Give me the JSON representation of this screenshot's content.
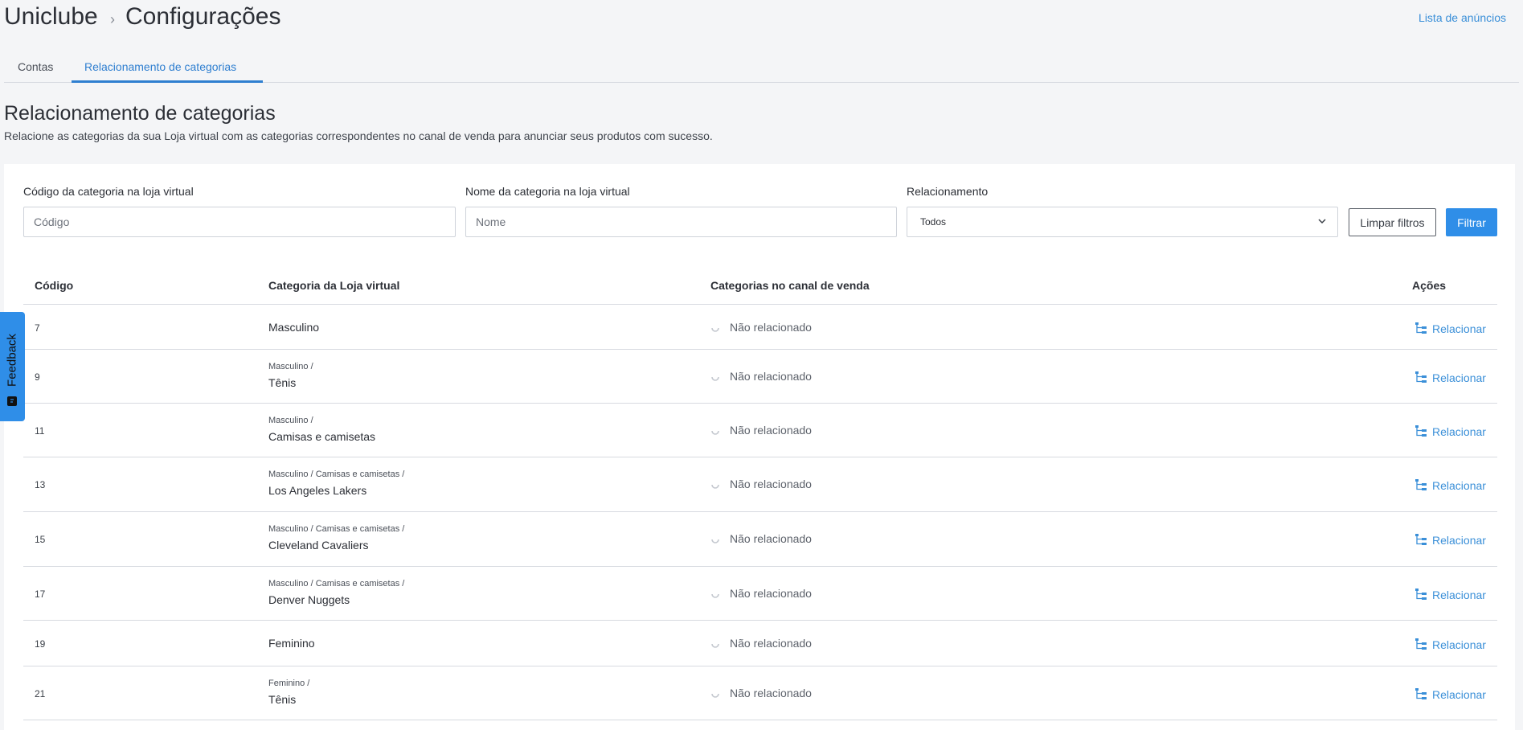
{
  "header": {
    "breadcrumb_root": "Uniclube",
    "breadcrumb_sep": "›",
    "breadcrumb_page": "Configurações",
    "top_link": "Lista de anúncios"
  },
  "tabs": [
    {
      "label": "Contas",
      "active": false
    },
    {
      "label": "Relacionamento de categorias",
      "active": true
    }
  ],
  "section": {
    "title": "Relacionamento de categorias",
    "description": "Relacione as categorias da sua Loja virtual com as categorias correspondentes no canal de venda para anunciar seus produtos com sucesso."
  },
  "filters": {
    "code": {
      "label": "Código da categoria na loja virtual",
      "placeholder": "Código",
      "value": ""
    },
    "name": {
      "label": "Nome da categoria na loja virtual",
      "placeholder": "Nome",
      "value": ""
    },
    "relation": {
      "label": "Relacionamento",
      "value": "Todos"
    },
    "clear_label": "Limpar filtros",
    "filter_label": "Filtrar"
  },
  "table": {
    "headers": [
      "Código",
      "Categoria da Loja virtual",
      "Categorias no canal de venda",
      "Ações"
    ],
    "rows": [
      {
        "code": "7",
        "path": "",
        "name": "Masculino",
        "status": "Não relacionado",
        "action": "Relacionar"
      },
      {
        "code": "9",
        "path": "Masculino /",
        "name": "Tênis",
        "status": "Não relacionado",
        "action": "Relacionar"
      },
      {
        "code": "11",
        "path": "Masculino /",
        "name": "Camisas e camisetas",
        "status": "Não relacionado",
        "action": "Relacionar"
      },
      {
        "code": "13",
        "path": "Masculino / Camisas e camisetas /",
        "name": "Los Angeles Lakers",
        "status": "Não relacionado",
        "action": "Relacionar"
      },
      {
        "code": "15",
        "path": "Masculino / Camisas e camisetas /",
        "name": "Cleveland Cavaliers",
        "status": "Não relacionado",
        "action": "Relacionar"
      },
      {
        "code": "17",
        "path": "Masculino / Camisas e camisetas /",
        "name": "Denver Nuggets",
        "status": "Não relacionado",
        "action": "Relacionar"
      },
      {
        "code": "19",
        "path": "",
        "name": "Feminino",
        "status": "Não relacionado",
        "action": "Relacionar"
      },
      {
        "code": "21",
        "path": "Feminino /",
        "name": "Tênis",
        "status": "Não relacionado",
        "action": "Relacionar"
      }
    ]
  },
  "feedback": {
    "label": "Feedback"
  },
  "icons": {
    "select_arrow": "chevron-down-icon",
    "status": "spinner-icon",
    "action": "sitemap-icon",
    "feedback": "comment-icon"
  },
  "colors": {
    "accent": "#2f8ee8",
    "link": "#3a8fd8",
    "background": "#f4f5f7",
    "panel": "#ffffff"
  }
}
